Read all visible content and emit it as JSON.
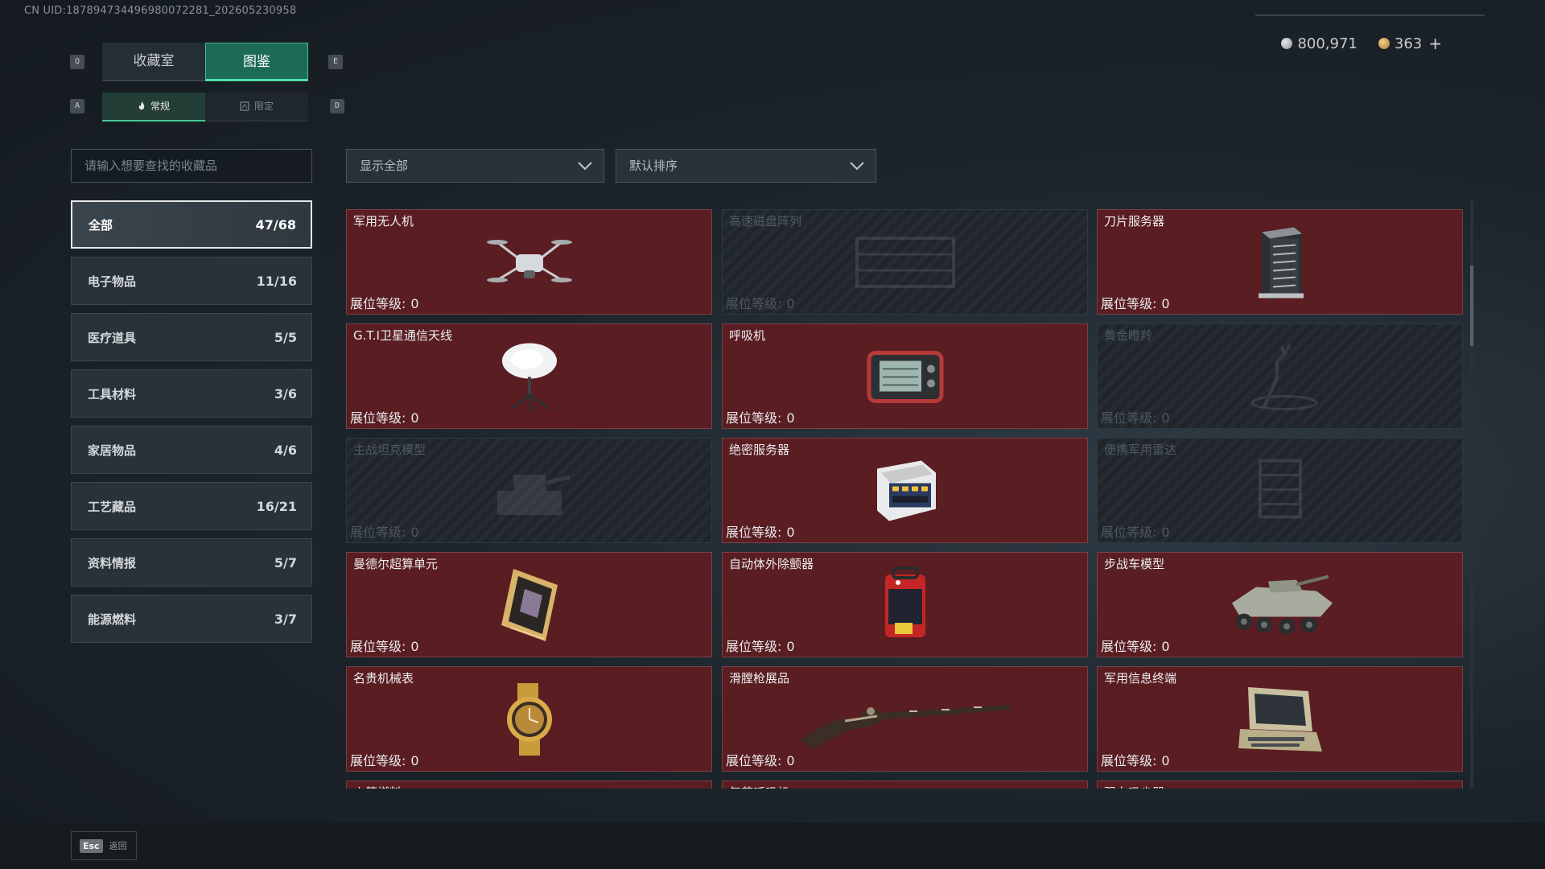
{
  "uid_text": "CN UID:18789473449698007228​1_202605230958",
  "currency": {
    "silver": "800,971",
    "gold": "363",
    "plus": "+"
  },
  "keys": {
    "q": "Q",
    "e": "E",
    "a": "A",
    "d": "D"
  },
  "tabs": [
    {
      "label": "收藏室"
    },
    {
      "label": "图鉴"
    }
  ],
  "subtabs": [
    {
      "label": "常规"
    },
    {
      "label": "限定"
    }
  ],
  "search": {
    "placeholder": "请输入想要查找的收藏品"
  },
  "filters": {
    "show": "显示全部",
    "sort": "默认排序"
  },
  "categories": [
    {
      "label": "全部",
      "count": "47/68"
    },
    {
      "label": "电子物品",
      "count": "11/16"
    },
    {
      "label": "医疗道具",
      "count": "5/5"
    },
    {
      "label": "工具材料",
      "count": "3/6"
    },
    {
      "label": "家居物品",
      "count": "4/6"
    },
    {
      "label": "工艺藏品",
      "count": "16/21"
    },
    {
      "label": "资料情报",
      "count": "5/7"
    },
    {
      "label": "能源燃料",
      "count": "3/7"
    }
  ],
  "level_label": "展位等级:",
  "items": [
    {
      "name": "军用无人机",
      "level": "0",
      "owned": true,
      "icon": "drone-icon"
    },
    {
      "name": "高速磁盘阵列",
      "level": "0",
      "owned": false,
      "icon": "disk-array-icon"
    },
    {
      "name": "刀片服务器",
      "level": "0",
      "owned": true,
      "icon": "blade-server-icon"
    },
    {
      "name": "G.T.I卫星通信天线",
      "level": "0",
      "owned": true,
      "icon": "satellite-dish-icon"
    },
    {
      "name": "呼吸机",
      "level": "0",
      "owned": true,
      "icon": "ventilator-icon"
    },
    {
      "name": "黄金瞪羚",
      "level": "0",
      "owned": false,
      "icon": "gazelle-icon"
    },
    {
      "name": "主战坦克模型",
      "level": "0",
      "owned": false,
      "icon": "tank-icon"
    },
    {
      "name": "绝密服务器",
      "level": "0",
      "owned": true,
      "icon": "secret-server-icon"
    },
    {
      "name": "便携军用雷达",
      "level": "0",
      "owned": false,
      "icon": "radar-icon"
    },
    {
      "name": "曼德尔超算单元",
      "level": "0",
      "owned": true,
      "icon": "supercomputer-icon"
    },
    {
      "name": "自动体外除颤器",
      "level": "0",
      "owned": true,
      "icon": "defibrillator-icon"
    },
    {
      "name": "步战车模型",
      "level": "0",
      "owned": true,
      "icon": "ifv-model-icon"
    },
    {
      "name": "名贵机械表",
      "level": "0",
      "owned": true,
      "icon": "watch-icon"
    },
    {
      "name": "滑膛枪展品",
      "level": "0",
      "owned": true,
      "icon": "musket-icon"
    },
    {
      "name": "军用信息终端",
      "level": "0",
      "owned": true,
      "icon": "terminal-icon"
    }
  ],
  "partial_row": [
    "火箭燃料",
    "复苏呼吸机",
    "强力吸尘器"
  ],
  "footer": {
    "esc_key": "Esc",
    "back_label": "返回"
  }
}
